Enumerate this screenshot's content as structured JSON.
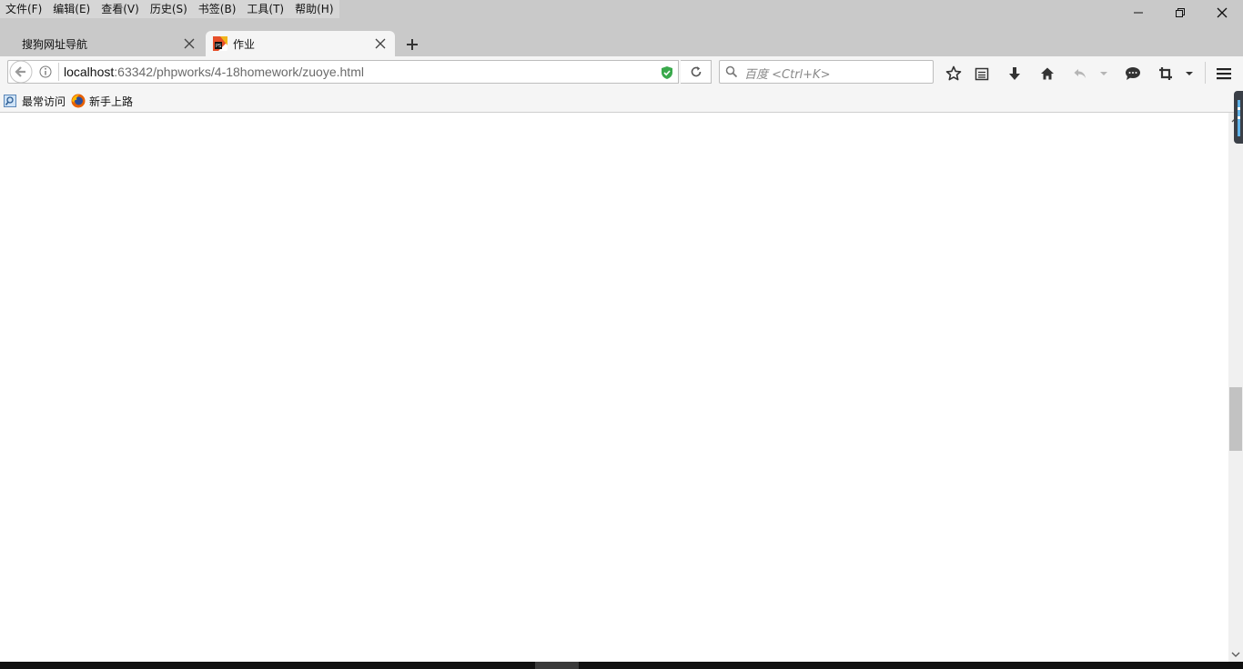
{
  "menu": {
    "items": [
      "文件(F)",
      "编辑(E)",
      "查看(V)",
      "历史(S)",
      "书签(B)",
      "工具(T)",
      "帮助(H)"
    ]
  },
  "window_controls": {
    "minimize_icon": "minimize-icon",
    "restore_icon": "restore-icon",
    "close_icon": "close-icon"
  },
  "tabs": [
    {
      "label": "搜狗网址导航",
      "active": false
    },
    {
      "label": "作业",
      "active": true
    }
  ],
  "navbar": {
    "url_host": "localhost",
    "url_path": ":63342/phpworks/4-18homework/zuoye.html",
    "search_placeholder": "百度 <Ctrl+K>"
  },
  "bookmarks": [
    {
      "label": "最常访问",
      "icon": "most-visited-icon"
    },
    {
      "label": "新手上路",
      "icon": "firefox-icon"
    }
  ],
  "colors": {
    "chrome_bg": "#c9c9c9",
    "toolbar_bg": "#f5f5f5",
    "shield_green": "#3aa94c"
  },
  "scroll": {
    "position_fraction": 0.57
  }
}
